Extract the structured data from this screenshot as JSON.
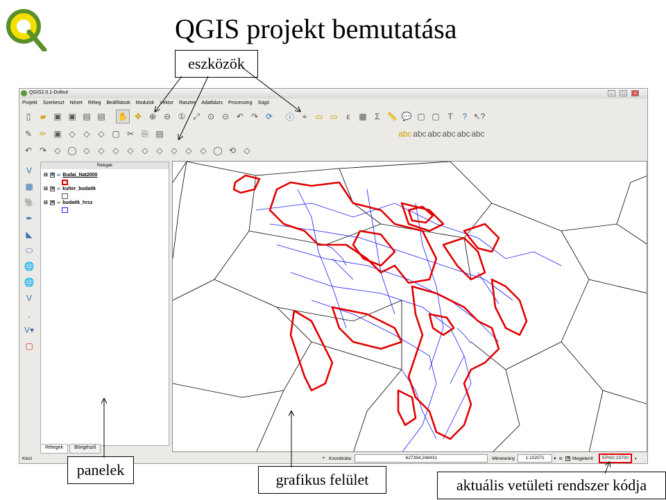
{
  "slide": {
    "title": "QGIS projekt bemutatása",
    "callouts": {
      "tools": "eszközök",
      "panels": "panelek",
      "canvas": "grafikus felület",
      "crs": "aktuális vetületi rendszer kódja"
    }
  },
  "window": {
    "title": "QGIS2.0.1-Dufour",
    "buttons": [
      "–",
      "□",
      "×"
    ]
  },
  "menu": [
    "Projekt",
    "Szerkeszt",
    "Nézet",
    "Réteg",
    "Beállítások",
    "Modulok",
    "Vektor",
    "Raszter",
    "Adatbázis",
    "Processing",
    "Súgó"
  ],
  "layers_panel": {
    "title": "Rétegek",
    "layers": [
      {
        "name": "Budai_Nat2000",
        "color": "#e00000"
      },
      {
        "name": "kulter_budaitk",
        "color": "#ffffff"
      },
      {
        "name": "budaitk_hrsz",
        "color": "#1a1aff"
      }
    ],
    "tabs": [
      "Rétegek",
      "Böngésző"
    ]
  },
  "status": {
    "ready": "Kész",
    "coord_label": "Koordináta:",
    "coord_value": "627394,248431",
    "scale_label": "Méretarány",
    "scale_value": "1:102071",
    "render_label": "Megjelenít",
    "crs_code": "EPSG:23700"
  },
  "colors": {
    "natura": "#e00000",
    "parcels": "#1a1aff",
    "outline": "#000000"
  }
}
